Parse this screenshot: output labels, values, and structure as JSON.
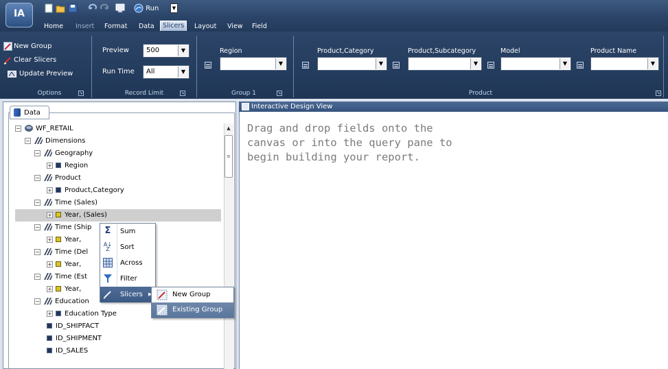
{
  "app": {
    "logo": "IA"
  },
  "quick_access": {
    "run_label": "Run"
  },
  "menu": [
    "Home",
    "Insert",
    "Format",
    "Data",
    "Slicers",
    "Layout",
    "View",
    "Field"
  ],
  "ribbon": {
    "options": {
      "new_group": "New Group",
      "clear_slicers": "Clear Slicers",
      "update_preview": "Update Preview",
      "label": "Options"
    },
    "record_limit": {
      "preview_label": "Preview",
      "preview_value": "500",
      "runtime_label": "Run Time",
      "runtime_value": "All",
      "label": "Record Limit"
    },
    "group1": {
      "field_label": "Region",
      "value": "",
      "label": "Group 1"
    },
    "product": {
      "fields": [
        "Product,Category",
        "Product,Subcategory",
        "Model",
        "Product Name"
      ],
      "label": "Product"
    }
  },
  "left_pane": {
    "tab": "Data",
    "tree": [
      {
        "label": "WF_RETAIL",
        "toggle": "−",
        "type": "root"
      },
      {
        "label": "Dimensions",
        "toggle": "−",
        "type": "dim"
      },
      {
        "label": "Geography",
        "toggle": "−",
        "type": "dim"
      },
      {
        "label": "Region",
        "toggle": "+",
        "type": "field"
      },
      {
        "label": "Product",
        "toggle": "−",
        "type": "dim"
      },
      {
        "label": "Product,Category",
        "toggle": "+",
        "type": "field"
      },
      {
        "label": "Time (Sales)",
        "toggle": "−",
        "type": "dim"
      },
      {
        "label": "Year, (Sales)",
        "toggle": "+",
        "type": "fieldy"
      },
      {
        "label": "Time (Ship",
        "toggle": "−",
        "type": "dim"
      },
      {
        "label": "Year,",
        "toggle": "+",
        "type": "fieldy"
      },
      {
        "label": "Time (Del",
        "toggle": "−",
        "type": "dim"
      },
      {
        "label": "Year,",
        "toggle": "+",
        "type": "fieldy"
      },
      {
        "label": "Time (Est",
        "toggle": "−",
        "type": "dim"
      },
      {
        "label": "Year,",
        "toggle": "+",
        "type": "fieldy"
      },
      {
        "label": "Education",
        "toggle": "−",
        "type": "dim"
      },
      {
        "label": "Education Type",
        "toggle": "+",
        "type": "field"
      },
      {
        "label": "ID_SHIPFACT",
        "toggle": "",
        "type": "field"
      },
      {
        "label": "ID_SHIPMENT",
        "toggle": "",
        "type": "field"
      },
      {
        "label": "ID_SALES",
        "toggle": "",
        "type": "field"
      }
    ]
  },
  "right_pane": {
    "title": "Interactive Design View",
    "hint": "Drag and drop fields onto the canvas or into the query pane to begin building your report."
  },
  "context_menu": {
    "items": [
      {
        "label": "Sum",
        "icon": "sum-icon"
      },
      {
        "label": "Sort",
        "icon": "sort-icon"
      },
      {
        "label": "Across",
        "icon": "across-icon"
      },
      {
        "label": "Filter",
        "icon": "filter-icon"
      },
      {
        "label": "Slicers",
        "icon": "slicers-icon"
      }
    ],
    "submenu": [
      {
        "label": "New Group",
        "icon": "new-group-icon"
      },
      {
        "label": "Existing Group",
        "icon": "existing-group-icon"
      }
    ]
  }
}
